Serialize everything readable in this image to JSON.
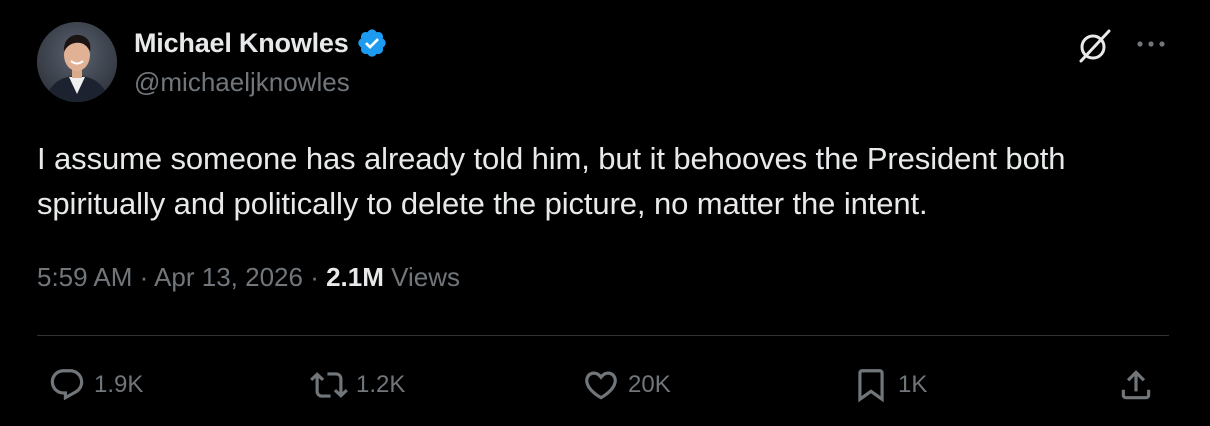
{
  "author": {
    "display_name": "Michael Knowles",
    "handle": "@michaeljknowles",
    "verified": true,
    "verified_color": "#1d9bf0"
  },
  "tweet": {
    "text": "I assume someone has already told him, but it behooves the President both spiritually and politically to delete the picture, no matter the intent."
  },
  "meta": {
    "time": "5:59 AM",
    "separator": " · ",
    "date": "Apr 13, 2026",
    "views_count": "2.1M",
    "views_label": " Views"
  },
  "actions": {
    "replies": "1.9K",
    "reposts": "1.2K",
    "likes": "20K",
    "bookmarks": "1K"
  },
  "icons": {
    "top_right": [
      "grok-icon",
      "more-icon"
    ],
    "action_bar": [
      "reply-icon",
      "repost-icon",
      "like-icon",
      "bookmark-icon",
      "share-icon"
    ]
  },
  "colors": {
    "background": "#000000",
    "primary_text": "#e7e9ea",
    "secondary_text": "#71767b",
    "divider": "#2f3336"
  }
}
